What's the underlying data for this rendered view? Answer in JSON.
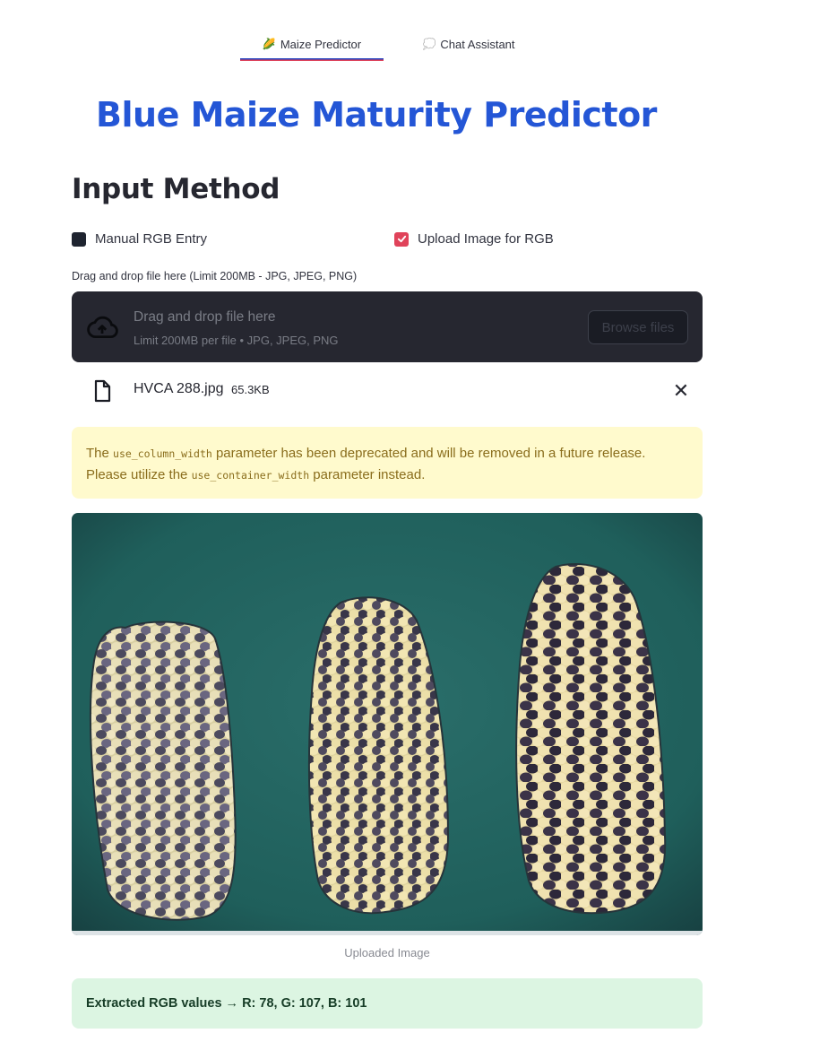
{
  "tabs": [
    {
      "icon": "corn-icon",
      "glyph": "🌽",
      "label": "Maize Predictor",
      "active": true
    },
    {
      "icon": "speech-bubble-icon",
      "glyph": "💭",
      "label": "Chat Assistant",
      "active": false
    }
  ],
  "page_title": "Blue Maize Maturity Predictor",
  "section_title": "Input Method",
  "input_options": [
    {
      "label": "Manual RGB Entry",
      "checked": false
    },
    {
      "label": "Upload Image for RGB",
      "checked": true
    }
  ],
  "uploader": {
    "label": "Drag and drop file here (Limit 200MB - JPG, JPEG, PNG)",
    "drop_text": "Drag and drop file here",
    "limit_text": "Limit 200MB per file • JPG, JPEG, PNG",
    "browse_label": "Browse files"
  },
  "uploaded_file": {
    "name": "HVCA 288.jpg",
    "size": "65.3KB",
    "remove_glyph": "✕"
  },
  "warning": {
    "text_1": "The ",
    "code_1": "use_column_width",
    "text_2": " parameter has been deprecated and will be removed in a future release. Please utilize the ",
    "code_2": "use_container_width",
    "text_3": " parameter instead."
  },
  "image": {
    "caption": "Uploaded Image"
  },
  "result": {
    "text": "Extracted RGB values → R: 78, G: 107, B: 101"
  },
  "colors": {
    "accent": "#e0435a",
    "title_blue": "#2456d6",
    "background_green": "#1f5f5b"
  }
}
